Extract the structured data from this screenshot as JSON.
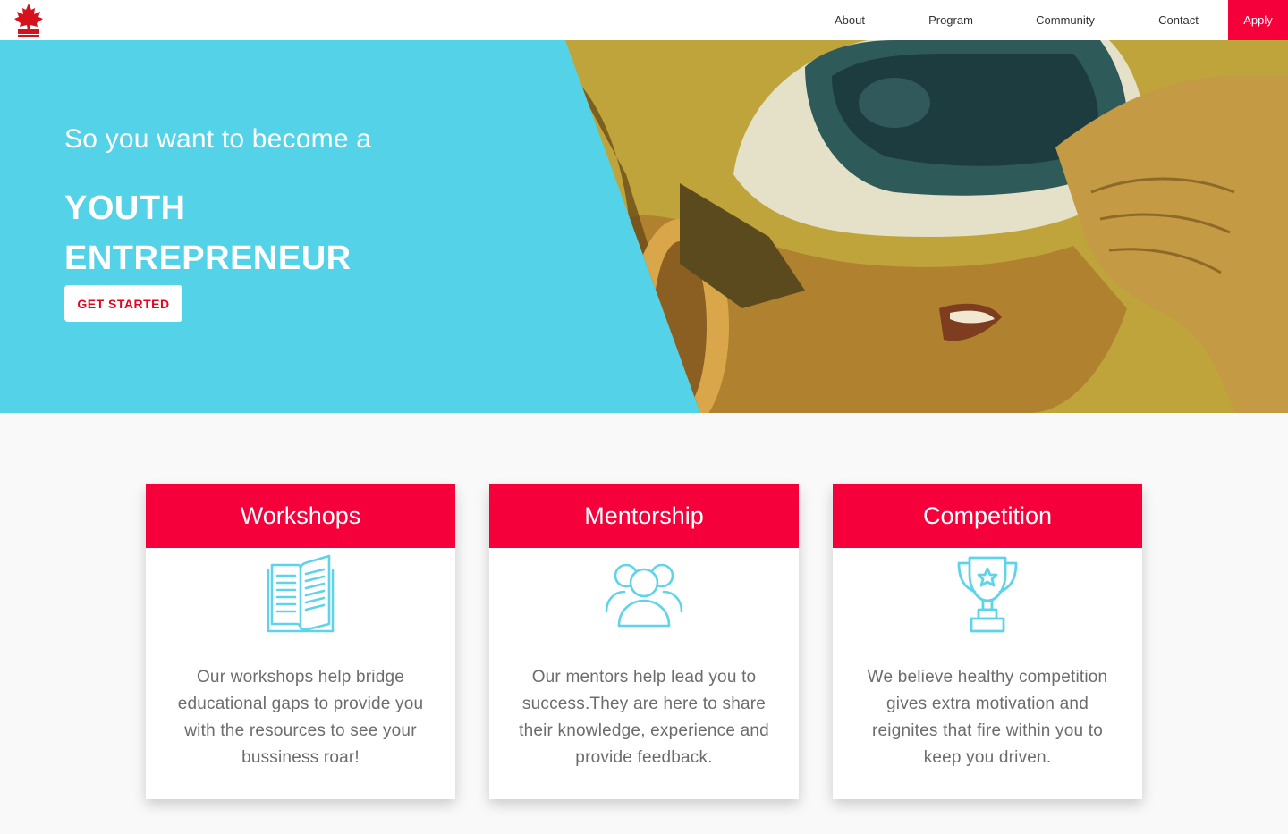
{
  "nav": {
    "logo_icon": "maple-leaf-logo",
    "links": [
      {
        "label": "About"
      },
      {
        "label": "Program"
      },
      {
        "label": "Community"
      },
      {
        "label": "Contact"
      },
      {
        "label": "Apply"
      }
    ]
  },
  "hero": {
    "kicker": "So you want to become a",
    "title_line1": "YOUTH",
    "title_line2": "ENTREPRENEUR",
    "cta_label": "GET STARTED",
    "photo_icon": "vr-headset-photo"
  },
  "cards": [
    {
      "title": "Workshops",
      "icon": "open-book-icon",
      "text": "Our workshops help bridge educational gaps to provide you with the resources to see your bussiness roar!"
    },
    {
      "title": "Mentorship",
      "icon": "group-people-icon",
      "text": "Our mentors help lead you to success.They are here to share their knowledge, experience and provide feedback."
    },
    {
      "title": "Competition",
      "icon": "trophy-icon",
      "text": "We believe healthy competition gives extra motivation and reignites that fire within you to keep you driven."
    }
  ],
  "colors": {
    "accent": "#f5003b",
    "hero_bg": "#53d2e8",
    "icon": "#5ed3e9",
    "photo_tint": "#c8a63a"
  }
}
